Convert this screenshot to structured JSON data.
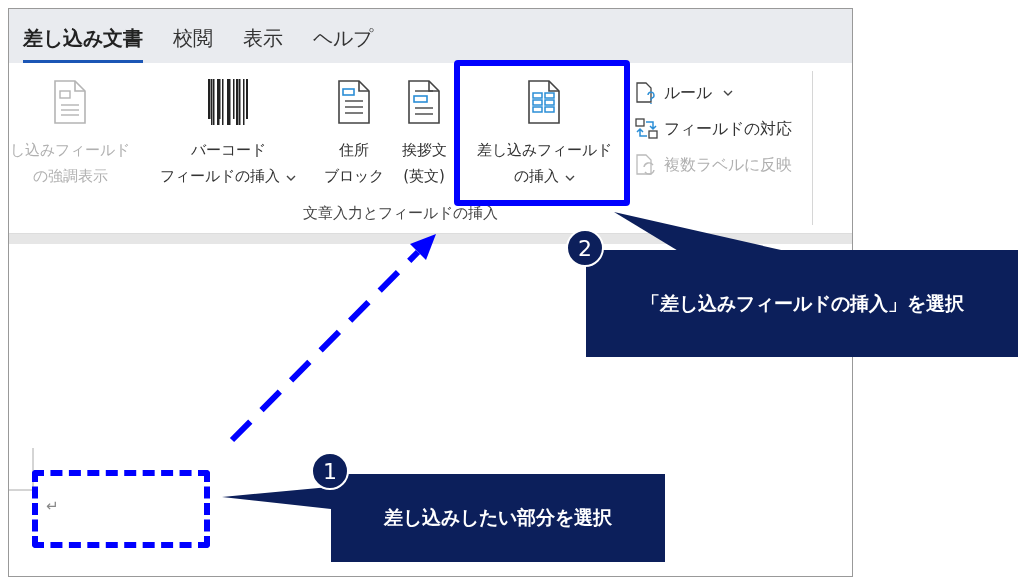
{
  "tabs": [
    {
      "label": "差し込み文書",
      "selected": true
    },
    {
      "label": "校閲",
      "selected": false
    },
    {
      "label": "表示",
      "selected": false
    },
    {
      "label": "ヘルプ",
      "selected": false
    }
  ],
  "ribbon": {
    "large_buttons": [
      {
        "kind": "document",
        "lines": [
          "し込みフィールド",
          "の強調表示"
        ],
        "disabled": true,
        "dropdown": false
      },
      {
        "kind": "barcode",
        "lines": [
          "バーコード",
          "フィールドの挿入"
        ],
        "disabled": false,
        "dropdown": true
      },
      {
        "kind": "address",
        "lines": [
          "住所",
          "ブロック"
        ],
        "disabled": false,
        "dropdown": false
      },
      {
        "kind": "greeting",
        "lines": [
          "挨拶文",
          "(英文)"
        ],
        "disabled": false,
        "dropdown": false
      },
      {
        "kind": "grid",
        "lines": [
          "差し込みフィールド",
          "の挿入"
        ],
        "disabled": false,
        "dropdown": true
      }
    ],
    "small_buttons": [
      {
        "kind": "rules",
        "label": "ルール",
        "disabled": false,
        "dropdown": true
      },
      {
        "kind": "match",
        "label": "フィールドの対応",
        "disabled": false,
        "dropdown": false
      },
      {
        "kind": "update",
        "label": "複数ラベルに反映",
        "disabled": true,
        "dropdown": false
      }
    ],
    "group_label": "文章入力とフィールドの挿入"
  },
  "document": {
    "paragraph_mark": "↵"
  },
  "callouts": [
    {
      "number": "2",
      "text": "「差し込みフィールドの挿入」を選択"
    },
    {
      "number": "1",
      "text": "差し込みしたい部分を選択"
    }
  ]
}
